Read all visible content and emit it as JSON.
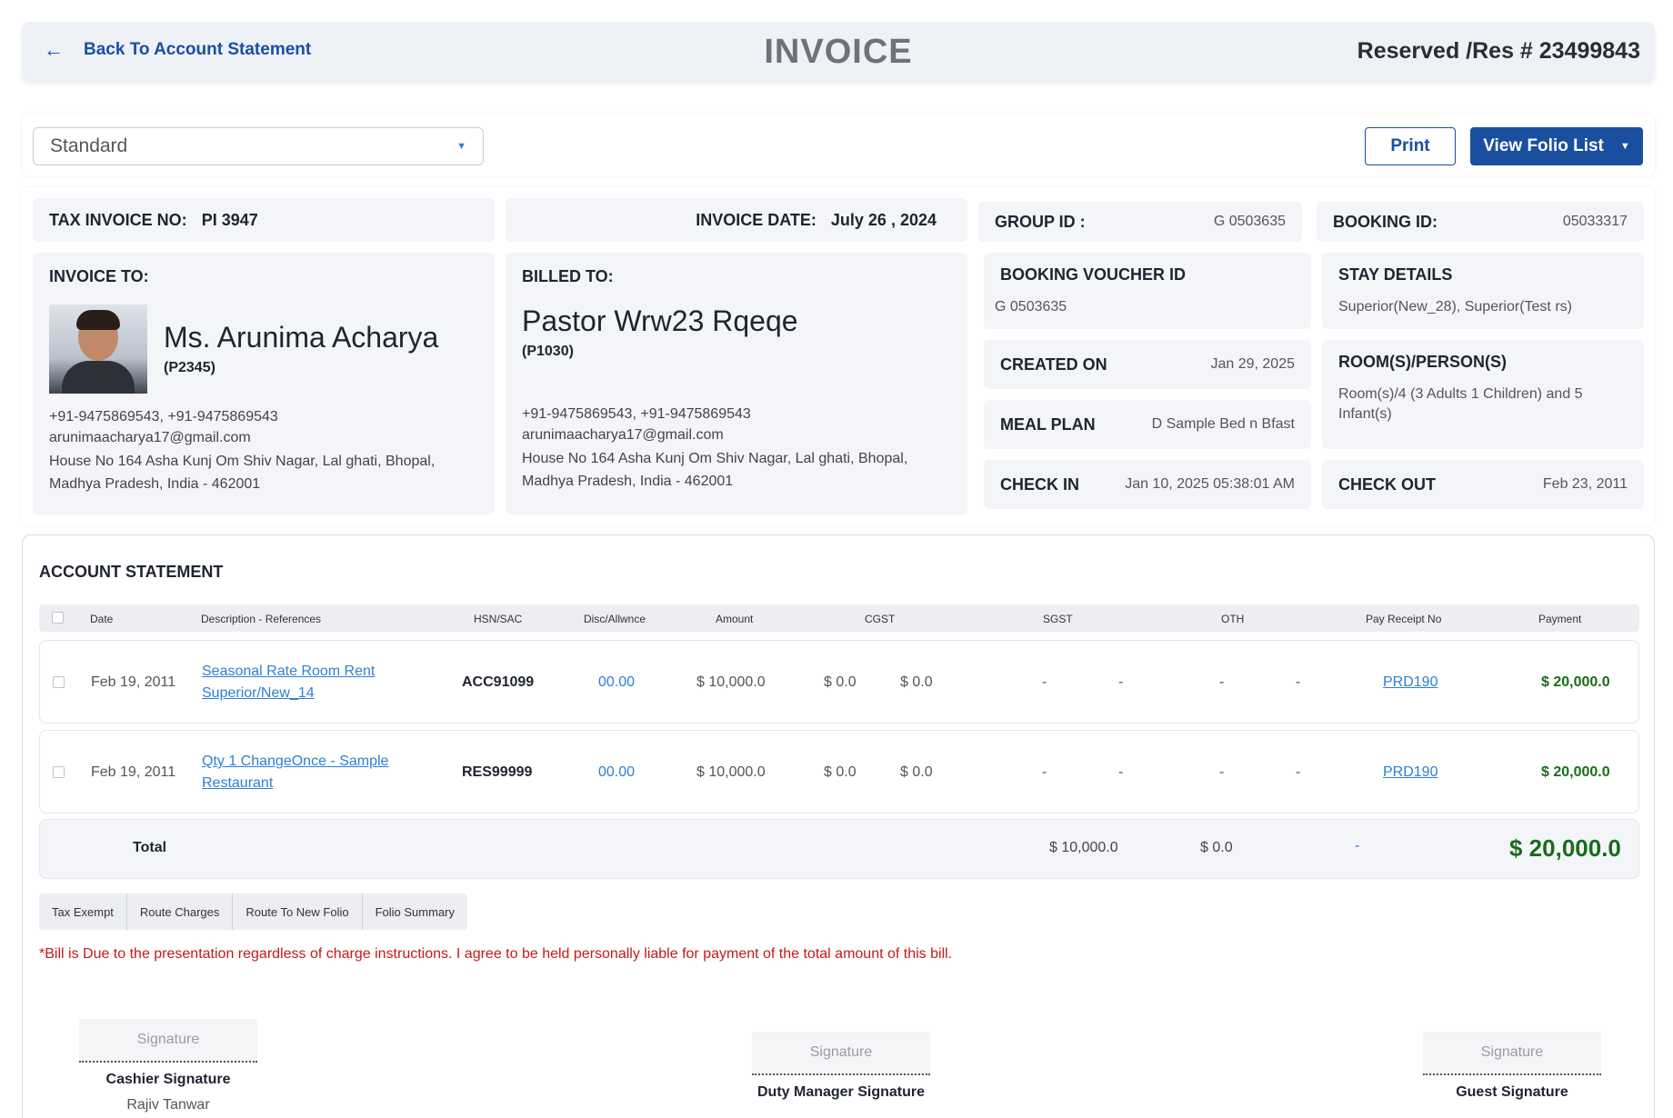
{
  "header": {
    "back_label": "Back To Account Statement",
    "title": "INVOICE",
    "reservation": "Reserved /Res # 23499843"
  },
  "toolbar": {
    "template_select": "Standard",
    "print_label": "Print",
    "folio_label": "View Folio List"
  },
  "invoice": {
    "tax_no_label": "TAX INVOICE NO:",
    "tax_no": "PI 3947",
    "date_label": "INVOICE DATE:",
    "date": "July 26 , 2024"
  },
  "invoice_to": {
    "heading": "INVOICE TO:",
    "name": "Ms. Arunima Acharya",
    "code": "(P2345)",
    "phones": "+91-9475869543,  +91-9475869543",
    "email": "arunimaacharya17@gmail.com",
    "address": "House No 164 Asha Kunj Om Shiv Nagar, Lal ghati, Bhopal, Madhya Pradesh, India - 462001"
  },
  "billed_to": {
    "heading": "BILLED TO:",
    "name": "Pastor Wrw23 Rqeqe",
    "code": "(P1030)",
    "phones": "+91-9475869543,  +91-9475869543",
    "email": "arunimaacharya17@gmail.com",
    "address": "House No 164 Asha Kunj Om Shiv Nagar, Lal ghati, Bhopal, Madhya Pradesh, India - 462001"
  },
  "booking": {
    "group_id_label": "GROUP ID :",
    "group_id": "G 0503635",
    "booking_id_label": "BOOKING ID:",
    "booking_id": "05033317",
    "voucher_label": "BOOKING VOUCHER ID",
    "voucher": "G 0503635",
    "stay_label": "STAY DETAILS",
    "stay": "Superior(New_28), Superior(Test rs)",
    "created_label": "CREATED ON",
    "created": "Jan 29, 2025",
    "rooms_label": "ROOM(S)/PERSON(S)",
    "rooms": "Room(s)/4 (3 Adults 1 Children) and 5 Infant(s)",
    "meal_label": "MEAL PLAN",
    "meal": "D Sample Bed n Bfast",
    "checkin_label": "CHECK IN",
    "checkin": "Jan 10, 2025 05:38:01 AM",
    "checkout_label": "CHECK OUT",
    "checkout": "Feb 23, 2011"
  },
  "statement": {
    "title": "ACCOUNT STATEMENT",
    "columns": [
      "Date",
      "Description - References",
      "HSN/SAC",
      "Disc/Allwnce",
      "Amount",
      "CGST",
      "SGST",
      "OTH",
      "Pay Receipt No",
      "Payment"
    ],
    "rows": [
      {
        "date": "Feb 19, 2011",
        "desc_1": "Seasonal Rate Room Rent",
        "desc_2": "Superior/New_14",
        "hsn": "ACC91099",
        "disc": "00.00",
        "amount": "$ 10,000.0",
        "cgst_1": "$ 0.0",
        "cgst_2": "$ 0.0",
        "sgst_1": "-",
        "sgst_2": "-",
        "oth_1": "-",
        "oth_2": "-",
        "receipt": "PRD190",
        "payment": "$ 20,000.0"
      },
      {
        "date": "Feb 19, 2011",
        "desc_1": "Qty 1 ChangeOnce  - Sample",
        "desc_2": "Restaurant",
        "hsn": "RES99999",
        "disc": "00.00",
        "amount": "$ 10,000.0",
        "cgst_1": "$ 0.0",
        "cgst_2": "$ 0.0",
        "sgst_1": "-",
        "sgst_2": "-",
        "oth_1": "-",
        "oth_2": "-",
        "receipt": "PRD190",
        "payment": "$ 20,000.0"
      }
    ],
    "total": {
      "label": "Total",
      "amount": "$ 10,000.0",
      "tax": "$ 0.0",
      "dash": "-",
      "payment": "$ 20,000.0"
    },
    "actions": [
      "Tax Exempt",
      "Route Charges",
      "Route To New Folio",
      "Folio Summary"
    ],
    "note": "*Bill is Due to the presentation regardless of charge instructions. I agree to be held personally liable for payment of the total amount of this bill."
  },
  "signatures": {
    "placeholder": "Signature",
    "cashier_label": "Cashier Signature",
    "cashier_name": "Rajiv Tanwar",
    "manager_label": "Duty Manager Signature",
    "guest_label": "Guest Signature"
  },
  "colors": {
    "primary": "#1a4fa0",
    "link": "#2e7fd6",
    "payment": "#1a6b1a",
    "warning": "#c41a1a"
  }
}
